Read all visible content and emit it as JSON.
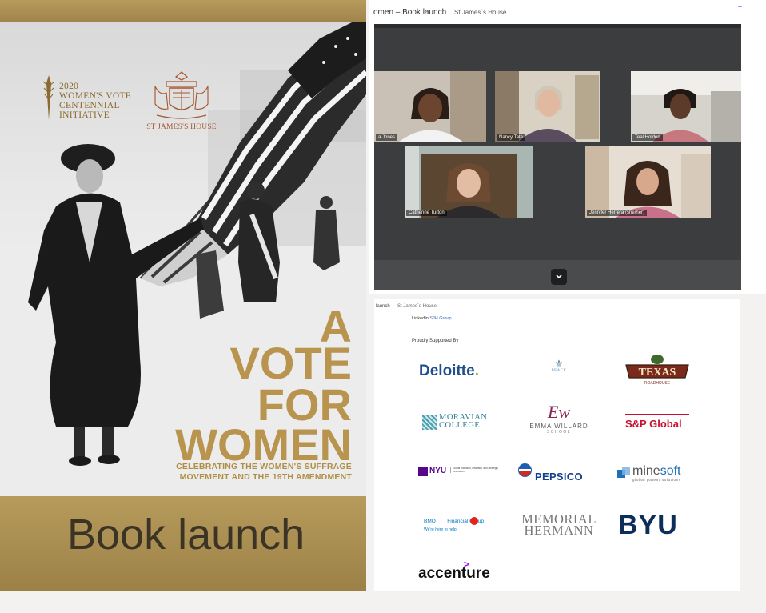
{
  "cover": {
    "logo_centennial_lines": [
      "2020",
      "WOMEN'S VOTE",
      "CENTENNIAL",
      "INITIATIVE"
    ],
    "logo_sjh": "ST JAMES'S HOUSE",
    "title_a": "A",
    "title_vote": "VOTE",
    "title_for": "FOR",
    "title_women": "WOMEN",
    "subtitle_line1": "CELEBRATING THE WOMEN'S SUFFRAGE",
    "subtitle_line2": "MOVEMENT AND THE 19TH AMENDMENT",
    "band_label": "Book launch",
    "colors": {
      "gold": "#b8944e",
      "band": "#a88c50"
    }
  },
  "call": {
    "window_title": "omen – Book launch",
    "window_subtitle": "St James´s House",
    "corner_mark": "T",
    "participants": [
      {
        "name": "a Jones"
      },
      {
        "name": "Nancy Tate"
      },
      {
        "name": "Teal Holden"
      },
      {
        "name": "Catherine Turton"
      },
      {
        "name": "Jennifer Herrera (she/her)"
      }
    ],
    "expand_icon": "chevron-down-icon"
  },
  "sponsors": {
    "crumb": "launch",
    "crumb_site": "St James´s House",
    "social_label": "LinkedIn",
    "social_group": "SJH Group",
    "heading": "Proudly Supported By",
    "logos": {
      "deloitte": "Deloitte",
      "peace_line1": "PEACE",
      "texas_line1": "TEXAS",
      "texas_line2": "ROADHOUSE",
      "moravian_line1": "MORAVIAN",
      "moravian_line2": "COLLEGE",
      "emma_mark": "Ew",
      "emma_name": "EMMA WILLARD",
      "emma_school": "SCHOOL",
      "sp_global": "S&P Global",
      "nyu": "NYU",
      "nyu_desc": "Global Inclusion, Diversity, and Strategic Innovation",
      "pepsico": "PEPSICO",
      "minesoft_a": "mine",
      "minesoft_b": "soft",
      "minesoft_sub": "global patent solutions",
      "bmo": "BMO",
      "bmo_group": "Financial Group",
      "bmo_tag": "We're here to help",
      "memorial_line1": "MEMORIAL",
      "memorial_line2": "HERMANN",
      "byu": "BYU",
      "accenture": "accenture"
    }
  }
}
